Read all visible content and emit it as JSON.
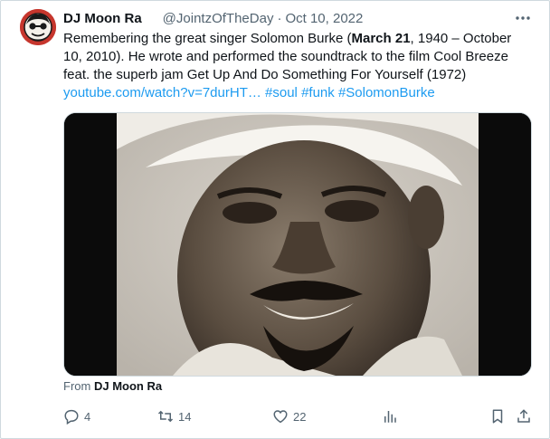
{
  "tweet": {
    "display_name": "DJ Moon Ra",
    "handle": "@JointzOfTheDay",
    "separator": "·",
    "date": "Oct 10, 2022",
    "more_icon": "more-horizontal-icon",
    "text": {
      "part1": "Remembering the great singer Solomon Burke (",
      "bold": "March 21",
      "part2": ", 1940 – October 10, 2010). He wrote and performed the soundtrack to the film Cool Breeze feat. the superb jam Get Up And Do Something For Yourself (1972)",
      "link_url": "youtube.com/watch?v=7durHT…",
      "hashtags": [
        "#soul",
        "#funk",
        "#SolomonBurke"
      ]
    },
    "media": {
      "from_label": "From",
      "from_name": "DJ Moon Ra"
    },
    "actions": {
      "reply_count": "4",
      "retweet_count": "14",
      "like_count": "22"
    },
    "colors": {
      "link": "#1d9bf0",
      "secondary_text": "#536471",
      "border": "#cfd9de"
    }
  }
}
